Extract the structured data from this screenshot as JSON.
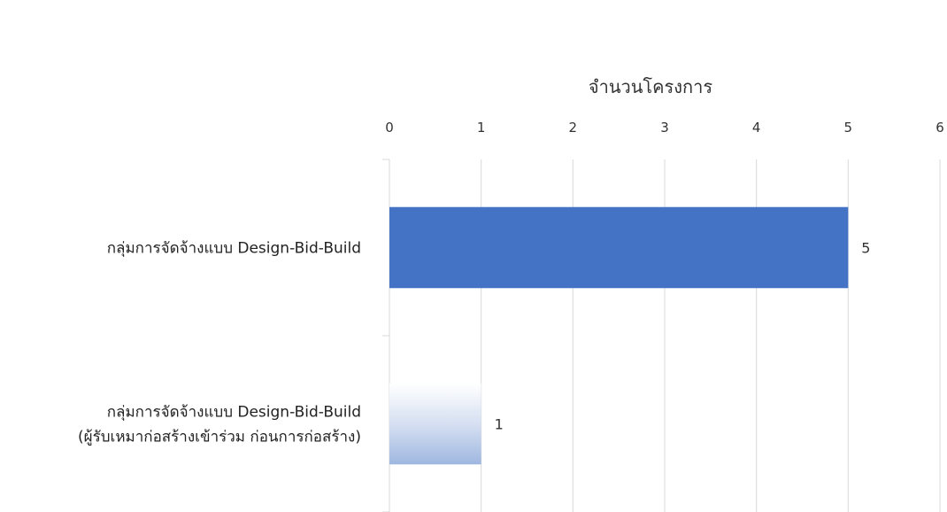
{
  "chart_data": {
    "type": "bar",
    "orientation": "horizontal",
    "axis_title": "จำนวนโครงการ",
    "axis_position": "top",
    "xlim": [
      0,
      6
    ],
    "ticks": [
      0,
      1,
      2,
      3,
      4,
      5,
      6
    ],
    "grid": true,
    "categories": [
      [
        "กลุ่มการจัดจ้างแบบ Design-Bid-Build"
      ],
      [
        "กลุ่มการจัดจ้างแบบ Design-Bid-Build",
        "(ผู้รับเหมาก่อสร้างเข้าร่วม ก่อนการก่อสร้าง)"
      ]
    ],
    "values": [
      5,
      1
    ],
    "colors": [
      "#4472c4",
      "gradient-light-blue"
    ],
    "show_data_labels": true
  }
}
